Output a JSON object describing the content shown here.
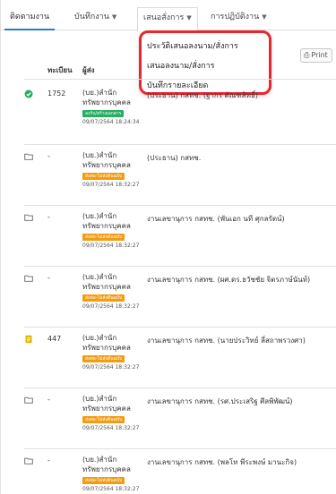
{
  "tabs": [
    {
      "label": "ติดตามงาน",
      "dropdown": false
    },
    {
      "label": "บันทึกงาน",
      "dropdown": true
    },
    {
      "label": "เสนอสั่งการ",
      "dropdown": true
    },
    {
      "label": "การปฏิบัติงาน",
      "dropdown": true
    }
  ],
  "dropdown_menu": {
    "items": [
      "ประวัติเสนอลงนาม/สั่งการ",
      "เสนอลงนาม/สั่งการ",
      "บันทึกรายละเอียด"
    ],
    "highlight_color": "#e8262f"
  },
  "print_label": "Print",
  "table": {
    "headers": {
      "number": "ทะเบียน",
      "sender": "ผู้ส่ง"
    },
    "rows": [
      {
        "icon": "check-circle-icon",
        "icon_color": "#27ae60",
        "number": "1752",
        "sender_line1": "(บย.)สำนัก",
        "sender_line2": "ทรัพยากรบุคคล",
        "tag": "ลงรับ/สร้างเอกสาร",
        "tag_color": "#27ae60",
        "timestamp": "09/07/2564 18:24:34",
        "recipient": "(ประธาน) กสทช. (ฐากร ตัณฑสิทธิ์)"
      },
      {
        "icon": "folder-icon",
        "icon_color": "#666666",
        "number": "-",
        "sender_line1": "(บย.)สำนัก",
        "sender_line2": "ทรัพยากรบุคคล",
        "tag": "ส่งต่อ-ไม่ส่งต้นฉบับ",
        "tag_color": "#f39c12",
        "timestamp": "09/07/2564 18:32:27",
        "recipient": "(ประธาน) กสทช."
      },
      {
        "icon": "folder-icon",
        "icon_color": "#666666",
        "number": "-",
        "sender_line1": "(บย.)สำนัก",
        "sender_line2": "ทรัพยากรบุคคล",
        "tag": "ส่งต่อ-ไม่ส่งต้นฉบับ",
        "tag_color": "#f39c12",
        "timestamp": "09/07/2564 18:32:27",
        "recipient": "งานเลขานุการ กสทช. (พันเอก นที ศุกลรัตน์)"
      },
      {
        "icon": "folder-icon",
        "icon_color": "#666666",
        "number": "-",
        "sender_line1": "(บย.)สำนัก",
        "sender_line2": "ทรัพยากรบุคคล",
        "tag": "ส่งต่อ-ไม่ส่งต้นฉบับ",
        "tag_color": "#f39c12",
        "timestamp": "09/07/2564 18:32:27",
        "recipient": "งานเลขานุการ กสทช. (ผศ.ดร.ธวัชชัย จิตรภาษ์นันท์)"
      },
      {
        "icon": "document-icon",
        "icon_color": "#e0b400",
        "number": "447",
        "sender_line1": "(บย.)สำนัก",
        "sender_line2": "ทรัพยากรบุคคล",
        "tag": "ส่งต่อ-ไม่ส่งต้นฉบับ",
        "tag_color": "#f39c12",
        "timestamp": "09/07/2564 18:32:27",
        "recipient": "งานเลขานุการ กสทช. (นายประวิทย์ ลี่สถาพรวงศา)"
      },
      {
        "icon": "folder-icon",
        "icon_color": "#666666",
        "number": "-",
        "sender_line1": "(บย.)สำนัก",
        "sender_line2": "ทรัพยากรบุคคล",
        "tag": "ส่งต่อ-ไม่ส่งต้นฉบับ",
        "tag_color": "#f39c12",
        "timestamp": "09/07/2564 18:32:27",
        "recipient": "งานเลขานุการ กสทช. (รศ.ประเสริฐ ศีลพิพัฒน์)"
      },
      {
        "icon": "folder-icon",
        "icon_color": "#666666",
        "number": "-",
        "sender_line1": "(บย.)สำนัก",
        "sender_line2": "ทรัพยากรบุคคล",
        "tag": "ส่งต่อ-ไม่ส่งต้นฉบับ",
        "tag_color": "#f39c12",
        "timestamp": "09/07/2564 18:32:27",
        "recipient": "งานเลขานุการ กสทช. (พลโท พีระพงษ์ มานะกิจ)"
      }
    ]
  }
}
